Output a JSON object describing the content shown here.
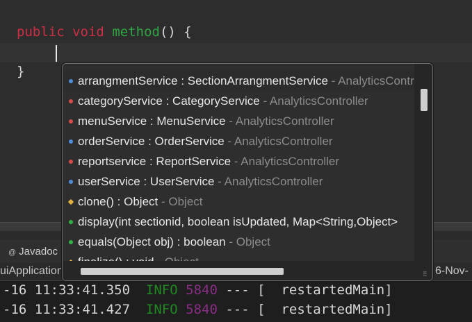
{
  "editor": {
    "line1": {
      "kw1": "public",
      "kw2": "void",
      "method": "method",
      "rest": "() {"
    },
    "line3": "}"
  },
  "completion": {
    "items": [
      {
        "icon": "public-field-icon",
        "name": "arrangmentService : SectionArrangmentService",
        "source": " - AnalyticsController"
      },
      {
        "icon": "private-field-icon",
        "name": "categoryService : CategoryService",
        "source": " - AnalyticsController"
      },
      {
        "icon": "private-field-icon",
        "name": "menuService : MenuService",
        "source": " - AnalyticsController"
      },
      {
        "icon": "public-field-icon",
        "name": "orderService : OrderService",
        "source": " - AnalyticsController"
      },
      {
        "icon": "private-field-icon",
        "name": "reportservice : ReportService",
        "source": " - AnalyticsController"
      },
      {
        "icon": "public-field-icon",
        "name": "userService : UserService",
        "source": " - AnalyticsController"
      },
      {
        "icon": "protected-method-icon",
        "name": "clone() : Object",
        "source": " - Object"
      },
      {
        "icon": "public-method-icon",
        "name": "display(int sectionid, boolean isUpdated, Map<String,Object>",
        "source": ""
      },
      {
        "icon": "public-method-icon",
        "name": "equals(Object obj) : boolean",
        "source": " - Object"
      },
      {
        "icon": "protected-method-icon",
        "name": "finalize() : void",
        "source": " - Object"
      }
    ]
  },
  "panel": {
    "javadoc_tab": "Javadoc",
    "console_title": "uiApplication",
    "console_date": "6-Nov-"
  },
  "console": {
    "lines": [
      {
        "time": "-16 11:33:41.350",
        "level": "INFO",
        "pid": "5840",
        "sep": "---",
        "bracket": "[",
        "thread": "restartedMain]"
      },
      {
        "time": "-16 11:33:41.427",
        "level": "INFO",
        "pid": "5840",
        "sep": "---",
        "bracket": "[",
        "thread": "restartedMain]"
      }
    ]
  }
}
